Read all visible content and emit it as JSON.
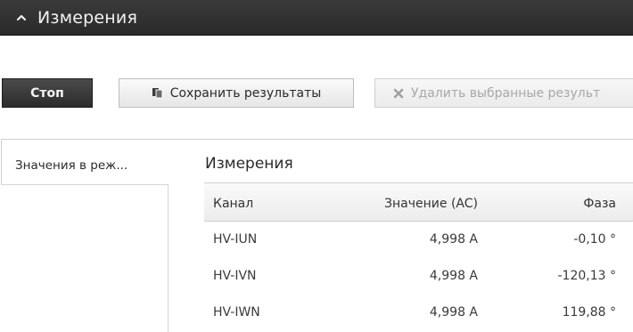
{
  "header": {
    "title": "Измерения",
    "toggle_icon": "chevron-up-icon"
  },
  "toolbar": {
    "stop_label": "Стоп",
    "save_label": "Сохранить результаты",
    "save_icon": "copy-icon",
    "delete_label": "Удалить выбранные результ",
    "delete_icon": "close-icon"
  },
  "sidebar": {
    "items": [
      {
        "label": "Значения в реж..."
      }
    ]
  },
  "main": {
    "section_title": "Измерения",
    "table": {
      "columns": [
        "Канал",
        "Значение (AC)",
        "Фаза"
      ],
      "rows": [
        {
          "channel": "HV-IUN",
          "value": "4,998 A",
          "phase": "-0,10 °"
        },
        {
          "channel": "HV-IVN",
          "value": "4,998 A",
          "phase": "-120,13 °"
        },
        {
          "channel": "HV-IWN",
          "value": "4,998 A",
          "phase": "119,88 °"
        }
      ]
    }
  },
  "colors": {
    "header_bg": "#2f2f2f",
    "stop_button_bg": "#333333",
    "disabled_text": "#a8a8a8"
  }
}
